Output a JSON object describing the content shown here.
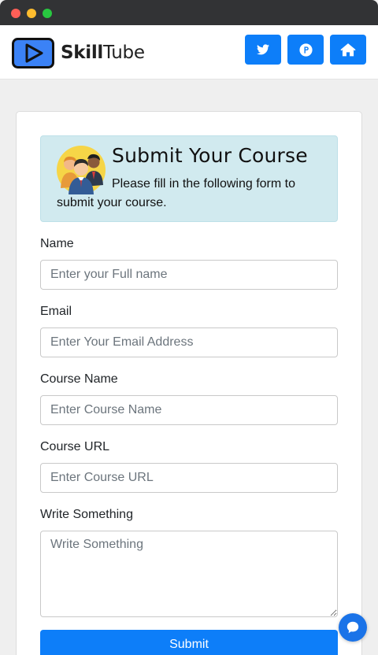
{
  "window": {
    "controls": [
      "close",
      "minimize",
      "maximize"
    ]
  },
  "brand": {
    "name_bold": "Skill",
    "name_regular": "Tube",
    "logo_icon": "play-icon"
  },
  "nav": {
    "buttons": [
      {
        "icon": "twitter-icon"
      },
      {
        "icon": "producthunt-icon"
      },
      {
        "icon": "home-icon"
      }
    ]
  },
  "intro": {
    "title": "Submit Your Course",
    "text": "Please fill in the following form to submit your course.",
    "image": "team-avatar"
  },
  "form": {
    "fields": [
      {
        "label": "Name",
        "placeholder": "Enter your Full name"
      },
      {
        "label": "Email",
        "placeholder": "Enter Your Email Address"
      },
      {
        "label": "Course Name",
        "placeholder": "Enter Course Name"
      },
      {
        "label": "Course URL",
        "placeholder": "Enter Course URL"
      }
    ],
    "message": {
      "label": "Write Something",
      "placeholder": "Write Something"
    },
    "submit_label": "Submit"
  },
  "chat": {
    "icon": "chat-bubble-icon"
  },
  "colors": {
    "primary": "#0d7ef9",
    "alert_bg": "#d1eaef",
    "page_bg": "#efefef",
    "titlebar": "#323335"
  }
}
